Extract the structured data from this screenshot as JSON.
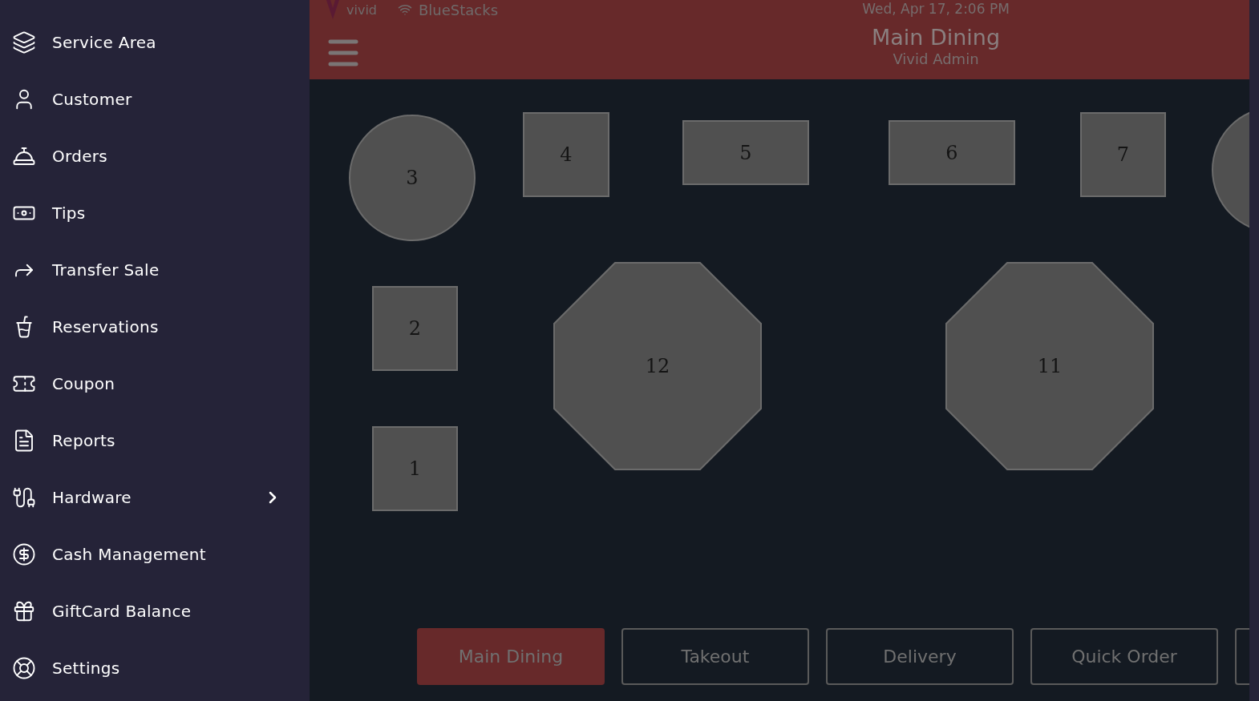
{
  "sidebar": {
    "items": [
      {
        "label": "Service Area",
        "has_submenu": false
      },
      {
        "label": "Customer",
        "has_submenu": false
      },
      {
        "label": "Orders",
        "has_submenu": false
      },
      {
        "label": "Tips",
        "has_submenu": false
      },
      {
        "label": "Transfer Sale",
        "has_submenu": false
      },
      {
        "label": "Reservations",
        "has_submenu": false
      },
      {
        "label": "Coupon",
        "has_submenu": false
      },
      {
        "label": "Reports",
        "has_submenu": false
      },
      {
        "label": "Hardware",
        "has_submenu": true
      },
      {
        "label": "Cash Management",
        "has_submenu": false
      },
      {
        "label": "GiftCard Balance",
        "has_submenu": false
      },
      {
        "label": "Settings",
        "has_submenu": false
      }
    ]
  },
  "status_bar": {
    "app_name": "vivid",
    "network": "BlueStacks",
    "datetime": "Wed, Apr 17, 2:06 PM"
  },
  "header": {
    "title": "Main Dining",
    "subtitle": "Vivid Admin"
  },
  "tables": [
    {
      "label": "3",
      "kind": "circle"
    },
    {
      "label": "4",
      "kind": "rect"
    },
    {
      "label": "5",
      "kind": "rect"
    },
    {
      "label": "6",
      "kind": "rect"
    },
    {
      "label": "7",
      "kind": "rect"
    },
    {
      "label": "2",
      "kind": "rect"
    },
    {
      "label": "12",
      "kind": "octagon"
    },
    {
      "label": "11",
      "kind": "octagon"
    },
    {
      "label": "1",
      "kind": "rect"
    }
  ],
  "service_tabs": [
    {
      "label": "Main Dining",
      "selected": true
    },
    {
      "label": "Takeout",
      "selected": false
    },
    {
      "label": "Delivery",
      "selected": false
    },
    {
      "label": "Quick Order",
      "selected": false
    }
  ]
}
